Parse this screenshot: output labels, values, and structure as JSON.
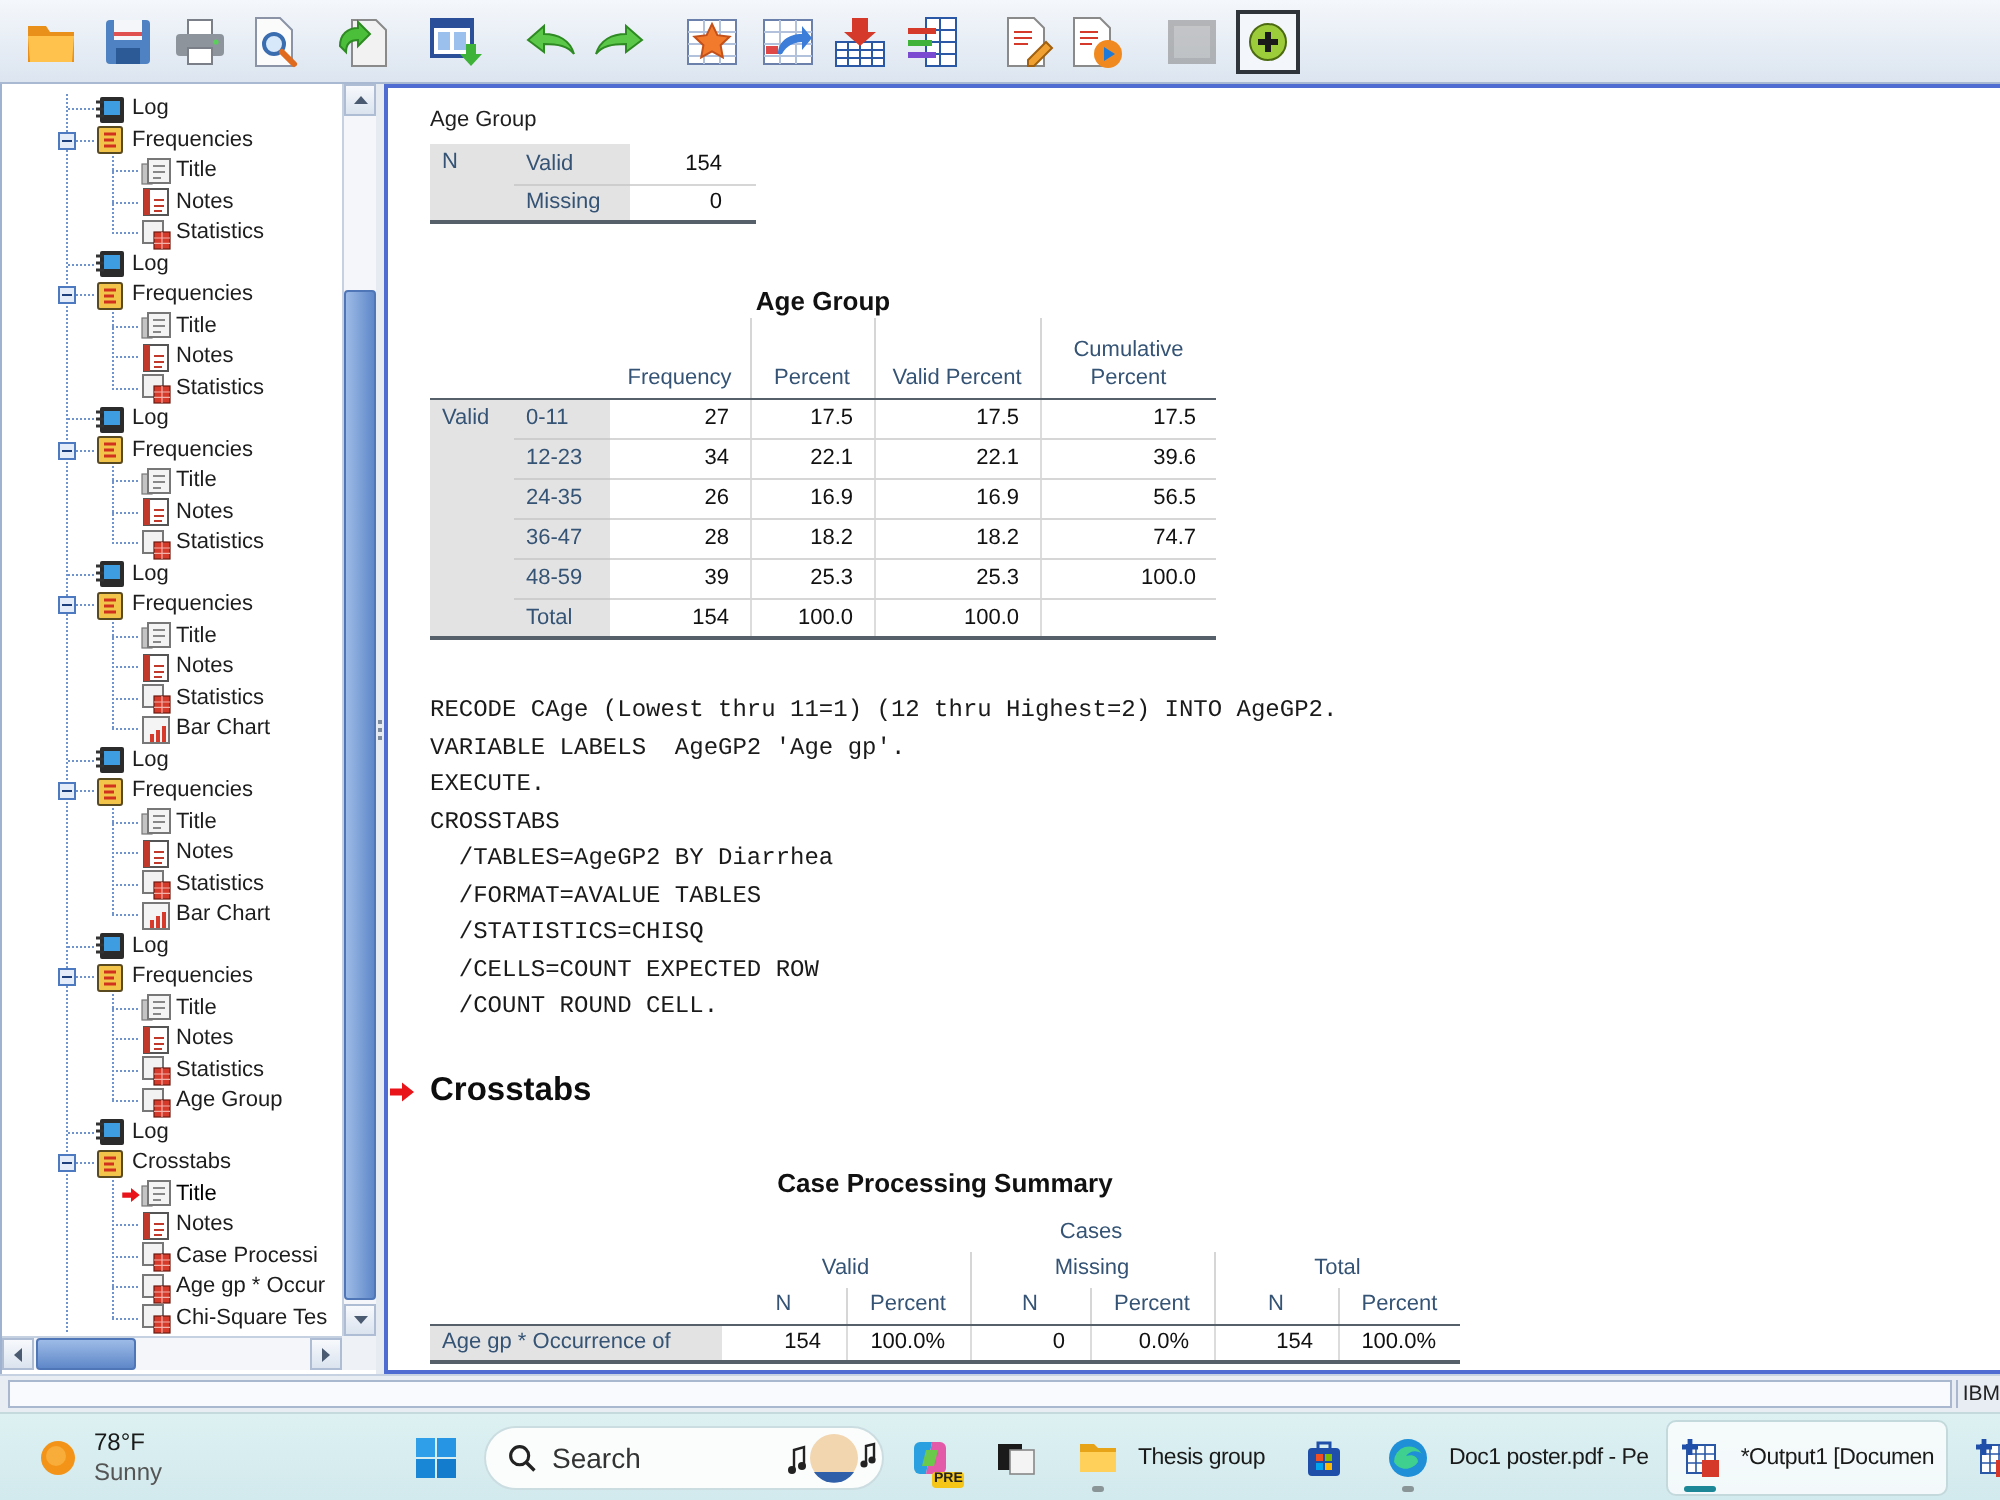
{
  "toolbar": {
    "buttons": [
      {
        "disabled": false,
        "pressed": false
      },
      {
        "disabled": false,
        "pressed": false
      },
      {
        "disabled": false,
        "pressed": false
      },
      {
        "disabled": false,
        "pressed": false
      },
      {
        "disabled": false,
        "pressed": false
      },
      {
        "disabled": false,
        "pressed": false
      },
      {
        "disabled": false,
        "pressed": false
      },
      {
        "disabled": false,
        "pressed": false
      },
      {
        "disabled": false,
        "pressed": false
      },
      {
        "disabled": false,
        "pressed": false
      },
      {
        "disabled": false,
        "pressed": false
      },
      {
        "disabled": false,
        "pressed": false
      },
      {
        "disabled": false,
        "pressed": false
      },
      {
        "disabled": false,
        "pressed": false
      },
      {
        "disabled": true,
        "pressed": false
      },
      {
        "disabled": false,
        "pressed": true
      }
    ]
  },
  "outline": {
    "items": [
      {
        "kind": "log",
        "label": "Log",
        "current": false
      },
      {
        "kind": "procedure",
        "label": "Frequencies",
        "expanded": true,
        "current": false,
        "children": [
          {
            "kind": "title",
            "label": "Title",
            "current": false
          },
          {
            "kind": "notes",
            "label": "Notes",
            "current": false
          },
          {
            "kind": "table",
            "label": "Statistics",
            "current": false
          }
        ]
      },
      {
        "kind": "log",
        "label": "Log",
        "current": false
      },
      {
        "kind": "procedure",
        "label": "Frequencies",
        "expanded": true,
        "current": false,
        "children": [
          {
            "kind": "title",
            "label": "Title",
            "current": false
          },
          {
            "kind": "notes",
            "label": "Notes",
            "current": false
          },
          {
            "kind": "table",
            "label": "Statistics",
            "current": false
          }
        ]
      },
      {
        "kind": "log",
        "label": "Log",
        "current": false
      },
      {
        "kind": "procedure",
        "label": "Frequencies",
        "expanded": true,
        "current": false,
        "children": [
          {
            "kind": "title",
            "label": "Title",
            "current": false
          },
          {
            "kind": "notes",
            "label": "Notes",
            "current": false
          },
          {
            "kind": "table",
            "label": "Statistics",
            "current": false
          }
        ]
      },
      {
        "kind": "log",
        "label": "Log",
        "current": false
      },
      {
        "kind": "procedure",
        "label": "Frequencies",
        "expanded": true,
        "current": false,
        "children": [
          {
            "kind": "title",
            "label": "Title",
            "current": false
          },
          {
            "kind": "notes",
            "label": "Notes",
            "current": false
          },
          {
            "kind": "table",
            "label": "Statistics",
            "current": false
          },
          {
            "kind": "chart",
            "label": "Bar Chart",
            "current": false
          }
        ]
      },
      {
        "kind": "log",
        "label": "Log",
        "current": false
      },
      {
        "kind": "procedure",
        "label": "Frequencies",
        "expanded": true,
        "current": false,
        "children": [
          {
            "kind": "title",
            "label": "Title",
            "current": false
          },
          {
            "kind": "notes",
            "label": "Notes",
            "current": false
          },
          {
            "kind": "table",
            "label": "Statistics",
            "current": false
          },
          {
            "kind": "chart",
            "label": "Bar Chart",
            "current": false
          }
        ]
      },
      {
        "kind": "log",
        "label": "Log",
        "current": false
      },
      {
        "kind": "procedure",
        "label": "Frequencies",
        "expanded": true,
        "current": false,
        "children": [
          {
            "kind": "title",
            "label": "Title",
            "current": false
          },
          {
            "kind": "notes",
            "label": "Notes",
            "current": false
          },
          {
            "kind": "table",
            "label": "Statistics",
            "current": false
          },
          {
            "kind": "table",
            "label": "Age Group",
            "current": false
          }
        ]
      },
      {
        "kind": "log",
        "label": "Log",
        "current": false
      },
      {
        "kind": "procedure",
        "label": "Crosstabs",
        "expanded": true,
        "current": false,
        "children": [
          {
            "kind": "title",
            "label": "Title",
            "current": true
          },
          {
            "kind": "notes",
            "label": "Notes",
            "current": false
          },
          {
            "kind": "table",
            "label": "Case Processi",
            "current": false
          },
          {
            "kind": "table",
            "label": "Age gp * Occur",
            "current": false
          },
          {
            "kind": "table",
            "label": "Chi-Square Tes",
            "current": false
          }
        ]
      }
    ]
  },
  "output": {
    "statistics": {
      "title": "Age Group",
      "group": "N",
      "rows": [
        {
          "label": "Valid",
          "value": "154"
        },
        {
          "label": "Missing",
          "value": "0"
        }
      ]
    },
    "frequencies": {
      "title": "Age Group",
      "columns": [
        "Frequency",
        "Percent",
        "Valid Percent",
        "Cumulative Percent"
      ],
      "group": "Valid",
      "rows": [
        {
          "label": "0-11",
          "cells": [
            "27",
            "17.5",
            "17.5",
            "17.5"
          ]
        },
        {
          "label": "12-23",
          "cells": [
            "34",
            "22.1",
            "22.1",
            "39.6"
          ]
        },
        {
          "label": "24-35",
          "cells": [
            "26",
            "16.9",
            "16.9",
            "56.5"
          ]
        },
        {
          "label": "36-47",
          "cells": [
            "28",
            "18.2",
            "18.2",
            "74.7"
          ]
        },
        {
          "label": "48-59",
          "cells": [
            "39",
            "25.3",
            "25.3",
            "100.0"
          ]
        },
        {
          "label": "Total",
          "cells": [
            "154",
            "100.0",
            "100.0"
          ]
        }
      ]
    },
    "syntax": [
      "RECODE CAge (Lowest thru 11=1) (12 thru Highest=2) INTO AgeGP2.",
      "VARIABLE LABELS  AgeGP2 'Age gp'.",
      "EXECUTE.",
      "CROSSTABS",
      "  /TABLES=AgeGP2 BY Diarrhea",
      "  /FORMAT=AVALUE TABLES",
      "  /STATISTICS=CHISQ",
      "  /CELLS=COUNT EXPECTED ROW",
      "  /COUNT ROUND CELL."
    ],
    "heading": {
      "text": "Crosstabs",
      "current": true
    },
    "case_summary": {
      "title": "Case Processing Summary",
      "spanner": "Cases",
      "groups": [
        "Valid",
        "Missing",
        "Total"
      ],
      "subcolumns": [
        "N",
        "Percent",
        "N",
        "Percent",
        "N",
        "Percent"
      ],
      "rows": [
        {
          "label": "Age gp * Occurrence of",
          "cells": [
            "154",
            "100.0%",
            "0",
            "0.0%",
            "154",
            "100.0%"
          ]
        }
      ]
    }
  },
  "status_bar": {
    "text": "IBM"
  },
  "taskbar": {
    "weather": {
      "temperature": "78°F",
      "condition": "Sunny"
    },
    "search": {
      "placeholder": "Search"
    },
    "apps": [
      {
        "kind": "copilot",
        "badge": "PRE",
        "running": false,
        "selected": false
      },
      {
        "kind": "tiles",
        "running": false,
        "selected": false
      },
      {
        "kind": "explorer",
        "label": "Thesis group",
        "running": true,
        "selected": false
      },
      {
        "kind": "store",
        "running": false,
        "selected": false
      },
      {
        "kind": "edge",
        "label": "Doc1 poster.pdf - Pe",
        "running": true,
        "selected": false
      },
      {
        "kind": "spss",
        "label": "*Output1 [Documen",
        "running": true,
        "selected": true
      },
      {
        "kind": "spss",
        "running": false,
        "selected": false
      }
    ]
  }
}
